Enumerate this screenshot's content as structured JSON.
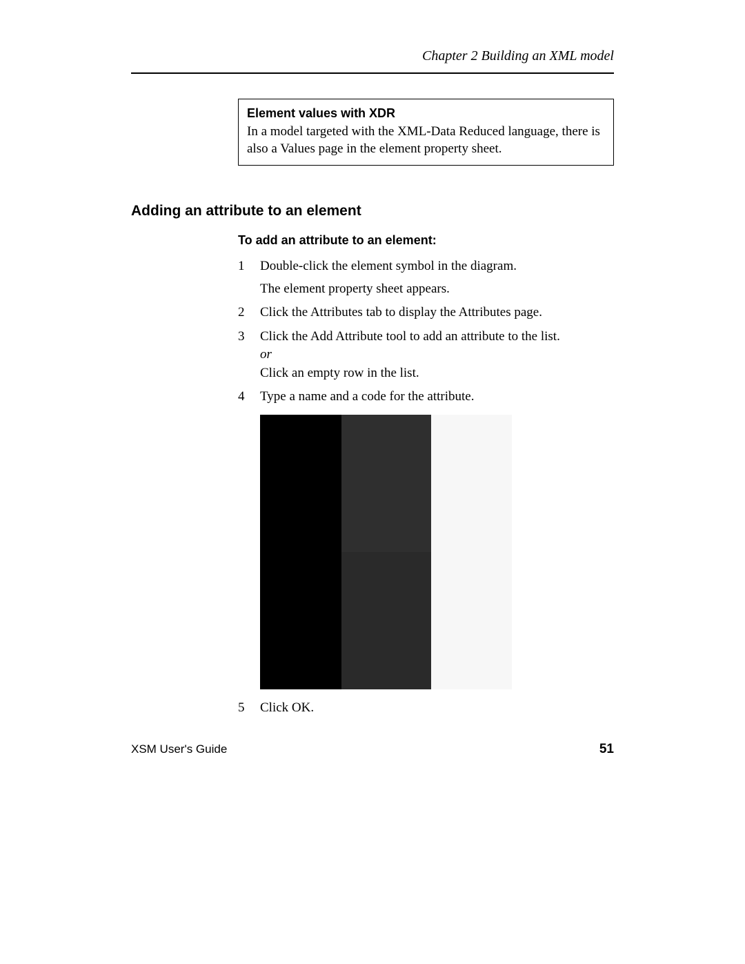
{
  "header": {
    "chapter": "Chapter 2  Building an XML model"
  },
  "note": {
    "title": "Element values with XDR",
    "body": "In a model targeted with the XML-Data Reduced language, there is also a Values page in the element property sheet."
  },
  "section_heading": "Adding an attribute to an element",
  "procedure_intro": "To add an attribute to an element:",
  "steps": {
    "s1_num": "1",
    "s1a": "Double-click the element symbol in the diagram.",
    "s1b": "The element property sheet appears.",
    "s2_num": "2",
    "s2": "Click the Attributes tab to display the Attributes page.",
    "s3_num": "3",
    "s3a": "Click the Add Attribute tool to add an attribute to the list.",
    "s3_or": "or",
    "s3b": "Click an empty row in the list.",
    "s4_num": "4",
    "s4": "Type a name and a code for the attribute.",
    "s5_num": "5",
    "s5": "Click OK."
  },
  "footer": {
    "guide": "XSM User's Guide",
    "page": "51"
  }
}
